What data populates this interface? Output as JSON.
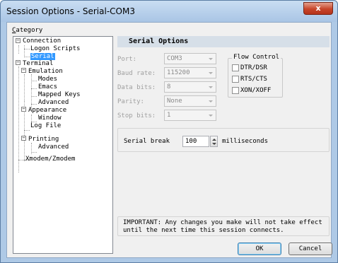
{
  "window": {
    "title": "Session Options - Serial-COM3",
    "close_glyph": "x"
  },
  "category": {
    "label_prefix": "C",
    "label_rest": "ategory"
  },
  "tree": [
    {
      "label": "Connection",
      "expander": "−"
    },
    {
      "label": "Logon Scripts"
    },
    {
      "label": "Serial",
      "selected": true
    },
    {
      "label": "Terminal",
      "expander": "−"
    },
    {
      "label": "Emulation",
      "expander": "−"
    },
    {
      "label": "Modes"
    },
    {
      "label": "Emacs"
    },
    {
      "label": "Mapped Keys"
    },
    {
      "label": "Advanced"
    },
    {
      "label": "Appearance",
      "expander": "−"
    },
    {
      "label": "Window"
    },
    {
      "label": "Log File"
    },
    {
      "label": "Printing",
      "expander": "−"
    },
    {
      "label": "Advanced"
    },
    {
      "label": "Xmodem/Zmodem"
    }
  ],
  "panel": {
    "header": "Serial Options"
  },
  "fields": {
    "port": {
      "label": "Port:",
      "value": "COM3"
    },
    "baud": {
      "label": "Baud rate:",
      "value": "115200"
    },
    "data_bits": {
      "label": "Data bits:",
      "value": "8"
    },
    "parity": {
      "label": "Parity:",
      "value": "None"
    },
    "stop_bits": {
      "label": "Stop bits:",
      "value": "1"
    }
  },
  "flow_control": {
    "title": "Flow Control",
    "options": [
      {
        "label": "DTR/DSR",
        "checked": false
      },
      {
        "label": "RTS/CTS",
        "checked": false
      },
      {
        "label": "XON/XOFF",
        "checked": false
      }
    ]
  },
  "serial_break": {
    "label": "Serial break",
    "value": "100",
    "unit": "milliseconds"
  },
  "notice": {
    "line1": "IMPORTANT: Any changes you make will not take effect",
    "line2": "until the next time this session connects."
  },
  "buttons": {
    "ok": "OK",
    "cancel": "Cancel"
  },
  "colors": {
    "selection": "#3399ff",
    "frame": "#aec9e6",
    "close": "#c7452a"
  }
}
